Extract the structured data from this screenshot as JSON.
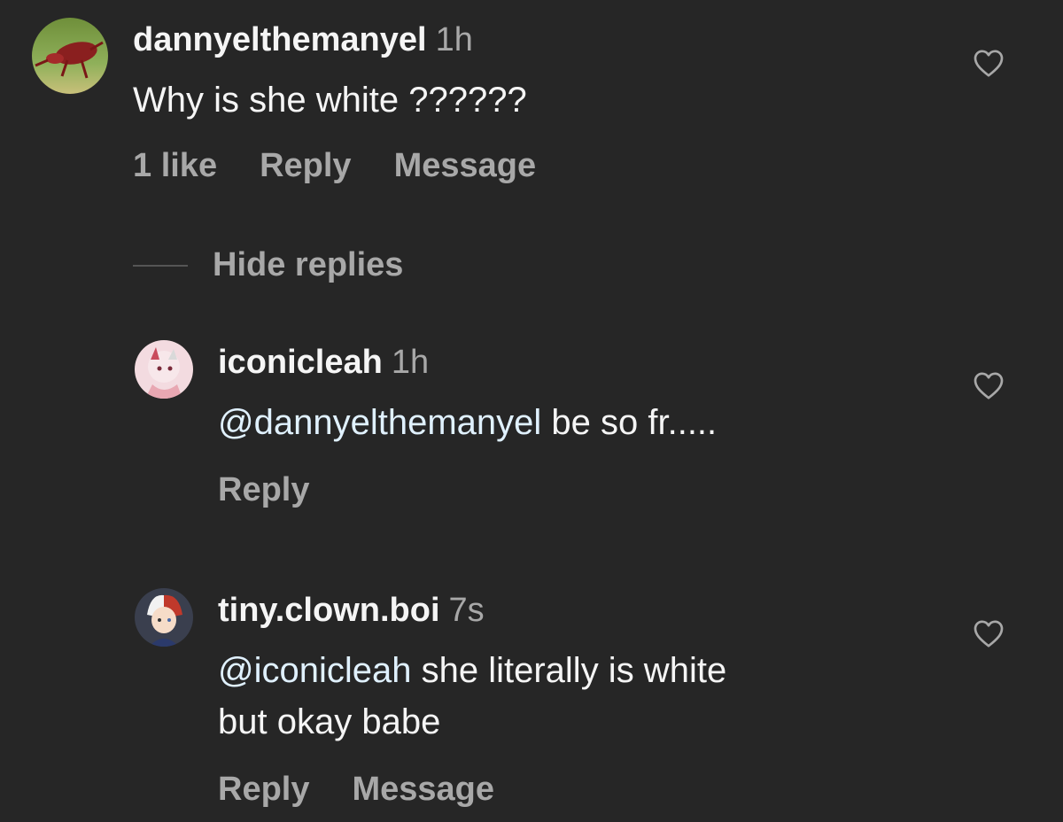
{
  "colors": {
    "background": "#262626",
    "text_primary": "#f5f5f5",
    "text_secondary": "#a8a8a8",
    "mention": "#e0f1ff"
  },
  "comments": [
    {
      "username": "dannyelthemanyel",
      "time": "1h",
      "text": "Why is she white ??????",
      "likes": "1 like",
      "reply_label": "Reply",
      "message_label": "Message",
      "icon": "heart-outline-icon"
    }
  ],
  "hide_replies_label": "Hide replies",
  "replies": [
    {
      "username": "iconicleah",
      "time": "1h",
      "mention": "@dannyelthemanyel",
      "text": " be so fr.....",
      "reply_label": "Reply",
      "icon": "heart-outline-icon"
    },
    {
      "username": "tiny.clown.boi",
      "time": "7s",
      "mention": "@iconicleah",
      "text": " she literally is white",
      "text_line2": "but okay babe",
      "reply_label": "Reply",
      "message_label": "Message",
      "icon": "heart-outline-icon"
    }
  ]
}
